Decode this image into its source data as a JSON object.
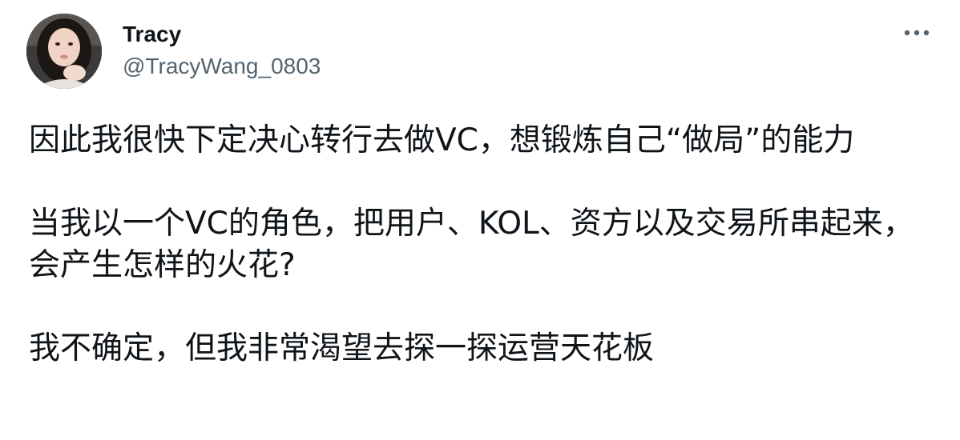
{
  "author": {
    "name": "Tracy",
    "handle": "@TracyWang_0803"
  },
  "tweet": {
    "paragraphs": [
      "因此我很快下定决心转行去做VC，想锻炼自己“做局”的能力",
      "当我以一个VC的角色，把用户、KOL、资方以及交易所串起来，会产生怎样的火花?",
      "我不确定，但我非常渴望去探一探运营天花板"
    ]
  },
  "icons": {
    "avatar": "profile-photo",
    "more": "more-horizontal-icon"
  },
  "colors": {
    "text": "#0f1419",
    "secondary": "#536471",
    "background": "#ffffff"
  }
}
